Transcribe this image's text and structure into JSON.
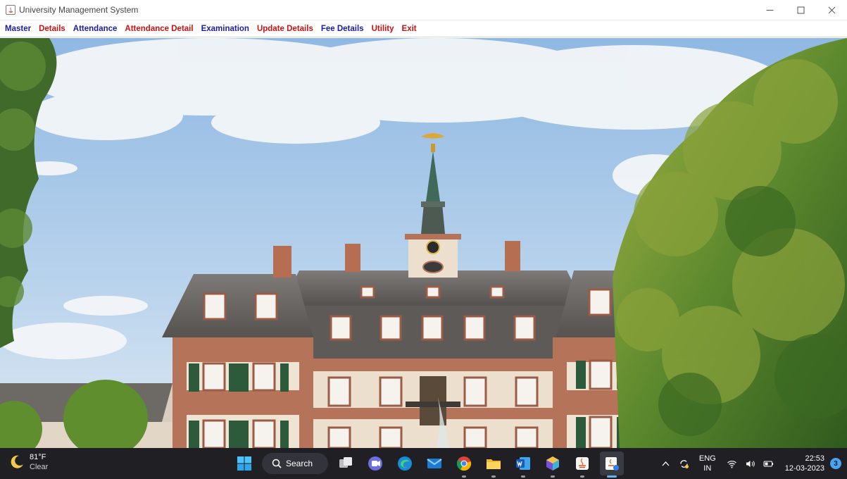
{
  "window": {
    "title": "University Management System"
  },
  "menu": [
    {
      "label": "Master",
      "color": "#1c1c9e"
    },
    {
      "label": "Details",
      "color": "#cc1111"
    },
    {
      "label": "Attendance",
      "color": "#1c1c9e"
    },
    {
      "label": "Attendance Detail",
      "color": "#cc1111"
    },
    {
      "label": "Examination",
      "color": "#1c1c9e"
    },
    {
      "label": "Update Details",
      "color": "#cc1111"
    },
    {
      "label": "Fee Details",
      "color": "#1c1c9e"
    },
    {
      "label": "Utility",
      "color": "#cc1111"
    },
    {
      "label": "Exit",
      "color": "#cc1111"
    }
  ],
  "main": {
    "image": "university-building-photo"
  },
  "taskbar": {
    "weather": {
      "temp": "81°F",
      "condition": "Clear",
      "icon": "moon-icon"
    },
    "search_label": "Search",
    "apps": [
      "start-icon",
      "search",
      "task-view-icon",
      "teams-chat-icon",
      "edge-icon",
      "mail-icon",
      "chrome-icon",
      "file-explorer-icon",
      "word-icon",
      "app-cube-icon",
      "java-icon",
      "java-app-icon"
    ],
    "tray": {
      "lang_line1": "ENG",
      "lang_line2": "IN",
      "time": "22:53",
      "date": "12-03-2023",
      "notifications": "3"
    }
  }
}
